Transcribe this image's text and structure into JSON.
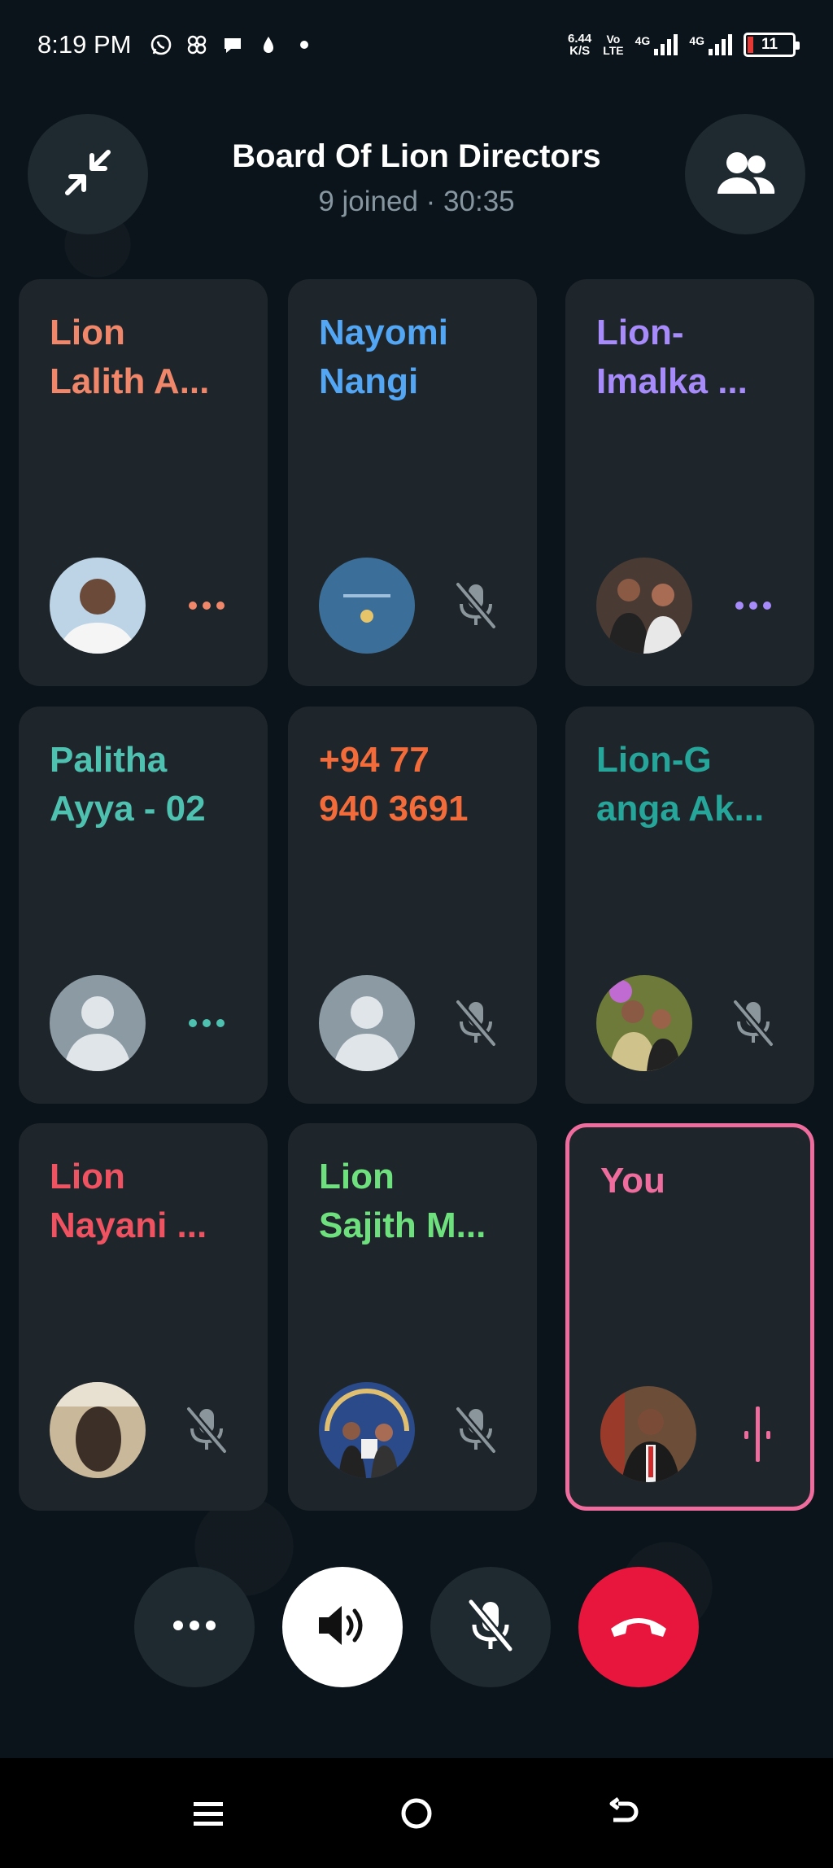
{
  "status_bar": {
    "time": "8:19 PM",
    "net_speed_value": "6.44",
    "net_speed_unit": "K/S",
    "volte_top": "Vo",
    "volte_bottom": "LTE",
    "sim1_label": "4G",
    "sim2_label": "4G",
    "battery_level": "11",
    "icons": [
      "whatsapp-icon",
      "app-icon",
      "message-icon",
      "drop-icon",
      "dot-icon"
    ]
  },
  "header": {
    "title": "Board Of Lion Directors",
    "subtitle": "9 joined · 30:35",
    "minimize_icon": "minimize-arrows-icon",
    "participants_icon": "participants-icon"
  },
  "participants": [
    {
      "name": "Lion\nLalith A...",
      "color": "#f0876a",
      "status": "connecting",
      "avatar": "photo-man-white-shirt"
    },
    {
      "name": "Nayomi\nNangi",
      "color": "#53a6f4",
      "status": "muted",
      "avatar": "photo-blue-logo"
    },
    {
      "name": "Lion-\nImalka ...",
      "color": "#a78bfa",
      "status": "connecting",
      "avatar": "photo-couple"
    },
    {
      "name": "Palitha\nAyya - 02",
      "color": "#4fc1b0",
      "status": "connecting",
      "avatar": "default-avatar"
    },
    {
      "name": "+94 77\n940 3691",
      "color": "#f26b3a",
      "status": "muted",
      "avatar": "default-avatar"
    },
    {
      "name": "Lion-G\nanga Ak...",
      "color": "#26a69a",
      "status": "muted",
      "avatar": "photo-couple-flowers"
    },
    {
      "name": "Lion\nNayani ...",
      "color": "#ef5261",
      "status": "muted",
      "avatar": "photo-blurry"
    },
    {
      "name": "Lion\nSajith M...",
      "color": "#6ee07d",
      "status": "muted",
      "avatar": "photo-award"
    },
    {
      "name": "You",
      "color": "#ef6c9f",
      "status": "speaking",
      "avatar": "photo-man-red-tie"
    }
  ],
  "controls": {
    "more_icon": "more-dots-icon",
    "speaker_icon": "speaker-icon",
    "mute_icon": "mic-off-icon",
    "end_icon": "end-call-icon"
  },
  "nav": {
    "recents_icon": "recents-icon",
    "home_icon": "home-icon",
    "back_icon": "back-icon"
  }
}
